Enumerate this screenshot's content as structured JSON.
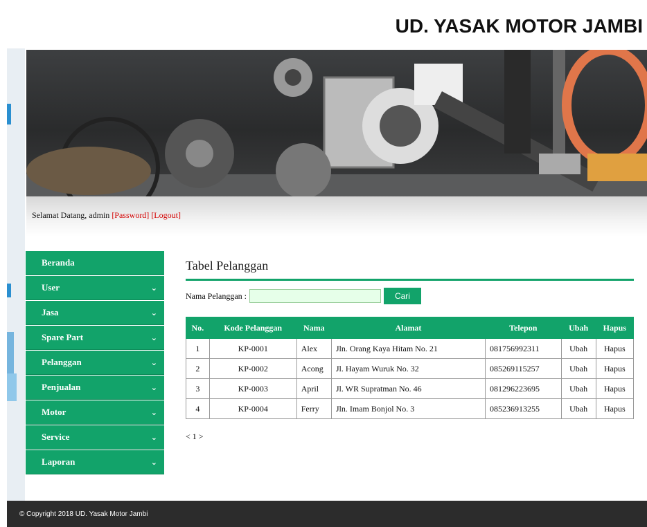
{
  "header": {
    "site_title": "UD. YASAK MOTOR JAMBI"
  },
  "welcome": {
    "greeting": "Selamat Datang, admin ",
    "password_link": "[Password]",
    "logout_link": "[Logout]"
  },
  "sidebar": {
    "items": [
      {
        "label": "Beranda",
        "chevron": ""
      },
      {
        "label": "User",
        "chevron": "⌄"
      },
      {
        "label": "Jasa",
        "chevron": "⌄"
      },
      {
        "label": "Spare Part",
        "chevron": "⌄"
      },
      {
        "label": "Pelanggan",
        "chevron": "⌄"
      },
      {
        "label": "Penjualan",
        "chevron": "⌄"
      },
      {
        "label": "Motor",
        "chevron": "⌄"
      },
      {
        "label": "Service",
        "chevron": "⌄"
      },
      {
        "label": "Laporan",
        "chevron": "⌄"
      }
    ]
  },
  "main": {
    "heading": "Tabel Pelanggan",
    "search": {
      "label": "Nama Pelanggan :",
      "value": "",
      "button": "Cari"
    },
    "table": {
      "columns": [
        "No.",
        "Kode Pelanggan",
        "Nama",
        "Alamat",
        "Telepon",
        "Ubah",
        "Hapus"
      ],
      "rows": [
        {
          "no": "1",
          "kode": "KP-0001",
          "nama": "Alex",
          "alamat": "Jln. Orang Kaya Hitam No. 21",
          "telepon": "081756992311",
          "ubah": "Ubah",
          "hapus": "Hapus"
        },
        {
          "no": "2",
          "kode": "KP-0002",
          "nama": "Acong",
          "alamat": "Jl. Hayam Wuruk No. 32",
          "telepon": "085269115257",
          "ubah": "Ubah",
          "hapus": "Hapus"
        },
        {
          "no": "3",
          "kode": "KP-0003",
          "nama": "April",
          "alamat": "Jl. WR Supratman No. 46",
          "telepon": "081296223695",
          "ubah": "Ubah",
          "hapus": "Hapus"
        },
        {
          "no": "4",
          "kode": "KP-0004",
          "nama": "Ferry",
          "alamat": "Jln. Imam Bonjol No. 3",
          "telepon": "085236913255",
          "ubah": "Ubah",
          "hapus": "Hapus"
        }
      ]
    },
    "pager": "< 1 >"
  },
  "footer": {
    "copyright": "© Copyright 2018 UD. Yasak Motor Jambi"
  },
  "colors": {
    "accent": "#12a36a",
    "link": "#d40000",
    "footer_bg": "#2c2c2c"
  }
}
